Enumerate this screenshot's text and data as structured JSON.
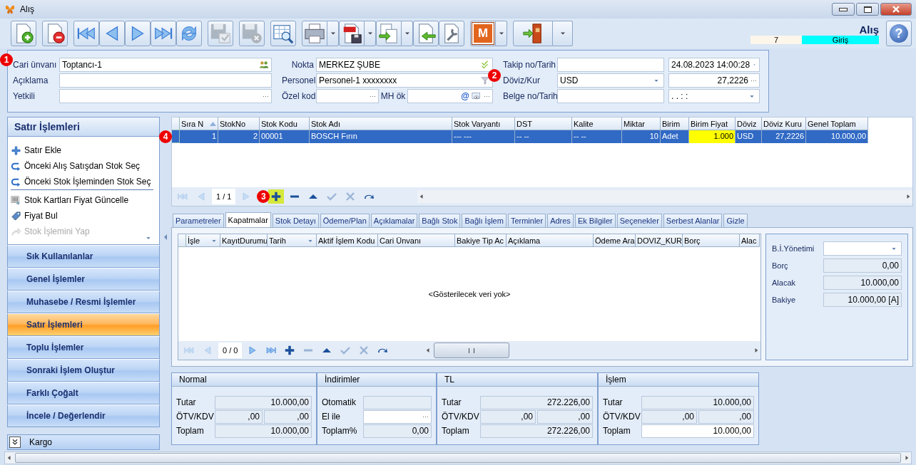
{
  "window": {
    "title": "Alış"
  },
  "toolbar": [
    {
      "kind": "new",
      "disabled": false,
      "dropdown": false
    },
    {
      "kind": "delete",
      "disabled": false,
      "dropdown": false
    },
    {
      "kind": "first",
      "disabled": false,
      "dropdown": false
    },
    {
      "kind": "prev",
      "disabled": false,
      "dropdown": false
    },
    {
      "kind": "next",
      "disabled": false,
      "dropdown": false
    },
    {
      "kind": "last",
      "disabled": false,
      "dropdown": false
    },
    {
      "kind": "refresh",
      "disabled": false,
      "dropdown": false
    },
    {
      "kind": "save",
      "disabled": true,
      "dropdown": false
    },
    {
      "kind": "savecancel",
      "disabled": true,
      "dropdown": false
    },
    {
      "kind": "preview",
      "disabled": false,
      "dropdown": false
    },
    {
      "kind": "printer",
      "disabled": false,
      "dropdown": true
    },
    {
      "kind": "pdf",
      "disabled": false,
      "dropdown": true
    },
    {
      "kind": "export",
      "disabled": false,
      "dropdown": true
    },
    {
      "kind": "import",
      "disabled": false,
      "dropdown": false
    },
    {
      "kind": "tool",
      "disabled": false,
      "dropdown": false
    },
    {
      "kind": "logo",
      "text": "M",
      "disabled": false,
      "dropdown": true
    },
    {
      "kind": "exit",
      "disabled": false,
      "dropdown": true
    }
  ],
  "document": {
    "title": "Alış",
    "number": "7",
    "direction": "Giriş",
    "help": "?"
  },
  "form": {
    "columns": [
      [
        {
          "label": "Cari ünvanı",
          "marker": "1",
          "fields": [
            {
              "value": "Toptancı-1",
              "kind": "people",
              "editable": true
            }
          ]
        },
        {
          "label": "Açıklama",
          "fields": [
            {
              "editable": true
            }
          ]
        },
        {
          "label": "Yetkili",
          "fields": [
            {
              "button": "···",
              "editable": true
            }
          ]
        }
      ],
      [
        {
          "label": "Nokta",
          "fields": [
            {
              "value": "MERKEZ ŞUBE",
              "kind": "check",
              "editable": true
            }
          ]
        },
        {
          "label": "Personel",
          "fields": [
            {
              "value": "Personel-1 xxxxxxxx",
              "kind": "filter",
              "editable": true
            }
          ]
        },
        {
          "label": "Özel kod",
          "fields": [
            {
              "button": "···",
              "editable": true
            },
            {
              "label": "MH ök",
              "at": "@",
              "kind": "card",
              "button": "···",
              "editable": true
            }
          ]
        }
      ],
      [
        {
          "label": "Takip no/Tarih",
          "fields": [
            {
              "editable": true
            },
            {
              "value": "24.08.2023 14:00:28",
              "dropdown": true,
              "editable": true
            }
          ]
        },
        {
          "label": "Döviz/Kur",
          "marker": "2",
          "fields": [
            {
              "value": "USD",
              "dropdown": true,
              "editable": true
            },
            {
              "value": "27,2226",
              "button": "···",
              "editable": true
            }
          ]
        },
        {
          "label": "Belge no/Tarih",
          "fields": [
            {
              "editable": true
            },
            {
              "value": ".  .       :  :",
              "dropdown": true,
              "editable": true
            }
          ]
        }
      ]
    ]
  },
  "sidebar": {
    "title": "Satır İşlemleri",
    "actions": [
      {
        "label": "Satır Ekle",
        "kind": "plus",
        "disabled": false,
        "divider": false
      },
      {
        "label": "Önceki Alış Satışdan Stok Seç",
        "kind": "back",
        "disabled": false,
        "divider": false
      },
      {
        "label": "Önceki Stok İşleminden Stok Seç",
        "kind": "back",
        "disabled": false,
        "divider": true
      },
      {
        "label": "Stok Kartları Fiyat Güncelle",
        "kind": "barcode",
        "disabled": false,
        "divider": false
      },
      {
        "label": "Fiyat Bul",
        "kind": "tag",
        "disabled": false,
        "divider": false
      },
      {
        "label": "Stok İşlemini Yap",
        "kind": "share",
        "disabled": true,
        "divider": false
      }
    ],
    "sections": [
      {
        "label": "Sık Kullanılanlar",
        "selected": false
      },
      {
        "label": "Genel İşlemler",
        "selected": false
      },
      {
        "label": "Muhasebe / Resmi İşlemler",
        "selected": false
      },
      {
        "label": "Satır İşlemleri",
        "selected": true
      },
      {
        "label": "Toplu İşlemler",
        "selected": false
      },
      {
        "label": "Sonraki İşlem Oluştur",
        "selected": false
      },
      {
        "label": "Farklı Çoğalt",
        "selected": false
      },
      {
        "label": "İncele / Değerlendir",
        "selected": false
      }
    ],
    "footer": "Kargo"
  },
  "lines": {
    "columns": [
      {
        "label": "Sıra N",
        "sorted": true,
        "highlighted": false
      },
      {
        "label": "StokNo",
        "sorted": false,
        "highlighted": false
      },
      {
        "label": "Stok Kodu",
        "sorted": false,
        "highlighted": false
      },
      {
        "label": "Stok Adı",
        "sorted": false,
        "highlighted": false
      },
      {
        "label": "Stok Varyantı",
        "sorted": false,
        "highlighted": false
      },
      {
        "label": "DST",
        "sorted": false,
        "highlighted": false
      },
      {
        "label": "Kalite",
        "sorted": false,
        "highlighted": false
      },
      {
        "label": "Miktar",
        "sorted": false,
        "highlighted": false
      },
      {
        "label": "Birim",
        "sorted": false,
        "highlighted": false
      },
      {
        "label": "Birim Fiyat",
        "sorted": false,
        "highlighted": true
      },
      {
        "label": "Döviz",
        "sorted": false,
        "highlighted": false
      },
      {
        "label": "Döviz Kuru",
        "sorted": false,
        "highlighted": false
      },
      {
        "label": "Genel Toplam",
        "sorted": false,
        "highlighted": false
      }
    ],
    "rows": [
      {
        "marker": "4",
        "selected": true,
        "cells": [
          "1",
          "2",
          "00001",
          "BOSCH Fırın",
          "--- ---",
          "-- --",
          "-- --",
          "10",
          "Adet",
          "1.000",
          "USD",
          "27,2226",
          "10.000,00"
        ]
      }
    ],
    "navigator": {
      "page": "1 / 1",
      "buttons": [
        {
          "kind": "first",
          "disabled": true,
          "highlighted": false
        },
        {
          "kind": "prev",
          "disabled": true,
          "highlighted": false
        },
        {
          "kind": "next",
          "disabled": true,
          "highlighted": false
        },
        {
          "kind": "add",
          "disabled": false,
          "highlighted": true,
          "marker": "3"
        },
        {
          "kind": "minus",
          "disabled": false,
          "highlighted": false
        },
        {
          "kind": "up",
          "disabled": false,
          "highlighted": false
        },
        {
          "kind": "ok",
          "disabled": true,
          "highlighted": false
        },
        {
          "kind": "cancel",
          "disabled": true,
          "highlighted": false
        },
        {
          "kind": "redo",
          "disabled": false,
          "highlighted": false
        }
      ]
    }
  },
  "tabs": [
    {
      "label": "Parametreler",
      "selected": false
    },
    {
      "label": "Kapatmalar",
      "selected": true
    },
    {
      "label": "Stok Detayı",
      "selected": false
    },
    {
      "label": "Ödeme/Plan",
      "selected": false
    },
    {
      "label": "Açıklamalar",
      "selected": false
    },
    {
      "label": "Bağlı Stok",
      "selected": false
    },
    {
      "label": "Bağlı İşlem",
      "selected": false
    },
    {
      "label": "Terminler",
      "selected": false
    },
    {
      "label": "Adres",
      "selected": false
    },
    {
      "label": "Ek Bilgiler",
      "selected": false
    },
    {
      "label": "Seçenekler",
      "selected": false
    },
    {
      "label": "Serbest Alanlar",
      "selected": false
    },
    {
      "label": "Gizle",
      "selected": false
    }
  ],
  "closings": {
    "columns": [
      {
        "label": "İşle",
        "filter": true
      },
      {
        "label": "KayıtDurumu",
        "filter": false
      },
      {
        "label": "Tarih",
        "filter": true
      },
      {
        "label": "Aktif İşlem Kodu",
        "filter": false
      },
      {
        "label": "Cari Ünvanı",
        "filter": false
      },
      {
        "label": "Bakiye Tip Ac",
        "filter": false
      },
      {
        "label": "Açıklama",
        "filter": false
      },
      {
        "label": "Ödeme Ara",
        "filter": false
      },
      {
        "label": "DOVIZ_KUR",
        "filter": false
      },
      {
        "label": "Borç",
        "filter": false
      },
      {
        "label": "Alac",
        "filter": false
      }
    ],
    "empty_text": "<Gösterilecek veri yok>",
    "navigator": {
      "page": "0 / 0",
      "buttons": [
        {
          "kind": "first",
          "disabled": true,
          "highlighted": false
        },
        {
          "kind": "prev",
          "disabled": true,
          "highlighted": false
        },
        {
          "kind": "next",
          "disabled": false,
          "highlighted": false
        },
        {
          "kind": "last",
          "disabled": false,
          "highlighted": false
        },
        {
          "kind": "add",
          "disabled": false,
          "highlighted": false
        },
        {
          "kind": "minus",
          "disabled": true,
          "highlighted": false
        },
        {
          "kind": "up",
          "disabled": false,
          "highlighted": false
        },
        {
          "kind": "ok",
          "disabled": true,
          "highlighted": false
        },
        {
          "kind": "cancel",
          "disabled": true,
          "highlighted": false
        },
        {
          "kind": "redo",
          "disabled": false,
          "highlighted": false
        }
      ]
    },
    "balance": [
      {
        "label": "B.İ.Yönetimi",
        "dropdown": true,
        "editable": true
      },
      {
        "label": "Borç",
        "value": "0,00",
        "editable": false
      },
      {
        "label": "Alacak",
        "value": "10.000,00",
        "editable": false
      },
      {
        "label": "Bakiye",
        "value": "10.000,00 [A]",
        "editable": false
      }
    ]
  },
  "totals": [
    {
      "title": "Normal",
      "rows": [
        {
          "label": "Tutar",
          "fields": [
            {
              "value": "10.000,00",
              "editable": false
            }
          ]
        },
        {
          "label": "ÖTV/KDV",
          "fields": [
            {
              "value": ",00",
              "editable": false
            },
            {
              "value": ",00",
              "editable": false
            }
          ]
        },
        {
          "label": "Toplam",
          "fields": [
            {
              "value": "10.000,00",
              "editable": false
            }
          ]
        }
      ]
    },
    {
      "title": "İndirimler",
      "rows": [
        {
          "label": "Otomatik",
          "fields": [
            {
              "editable": false
            }
          ]
        },
        {
          "label": "El ile",
          "fields": [
            {
              "button": "···",
              "editable": true
            }
          ]
        },
        {
          "label": "Toplam%",
          "fields": [
            {
              "value": "0,00",
              "editable": false
            }
          ]
        }
      ]
    },
    {
      "title": "TL",
      "rows": [
        {
          "label": "Tutar",
          "fields": [
            {
              "value": "272.226,00",
              "editable": false
            }
          ]
        },
        {
          "label": "ÖTV/KDV",
          "fields": [
            {
              "value": ",00",
              "editable": false
            },
            {
              "value": ",00",
              "editable": false
            }
          ]
        },
        {
          "label": "Toplam",
          "fields": [
            {
              "value": "272.226,00",
              "editable": false
            }
          ]
        }
      ]
    },
    {
      "title": "İşlem",
      "rows": [
        {
          "label": "Tutar",
          "fields": [
            {
              "value": "10.000,00",
              "editable": false
            }
          ]
        },
        {
          "label": "ÖTV/KDV",
          "fields": [
            {
              "value": ",00",
              "editable": false
            },
            {
              "value": ",00",
              "editable": false
            }
          ]
        },
        {
          "label": "Toplam",
          "fields": [
            {
              "value": "10.000,00",
              "editable": true
            }
          ]
        }
      ]
    }
  ]
}
